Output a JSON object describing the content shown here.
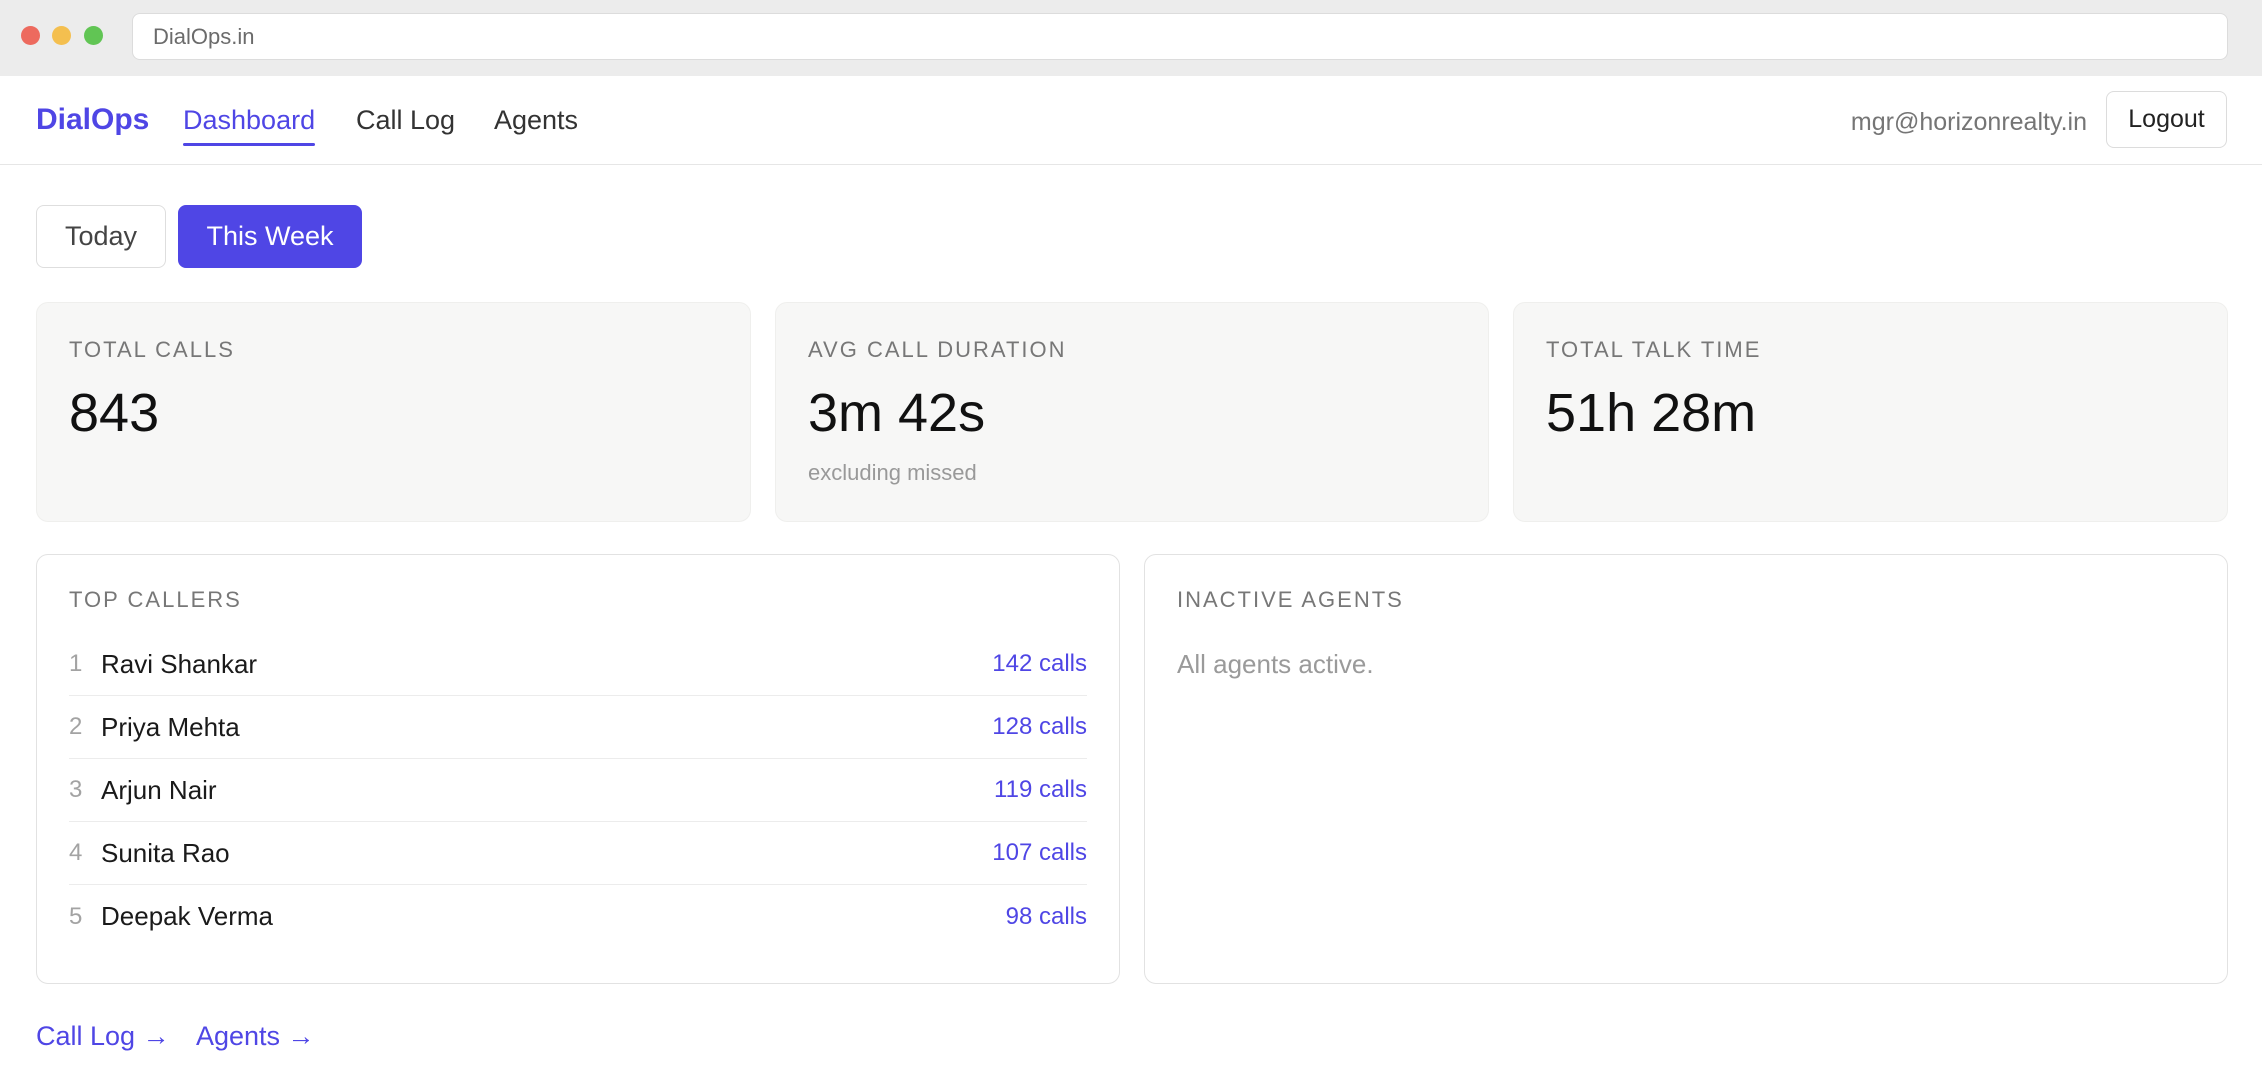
{
  "browser": {
    "url": "DialOps.in"
  },
  "header": {
    "brand": "DialOps",
    "nav": {
      "dashboard": "Dashboard",
      "call_log": "Call Log",
      "agents": "Agents"
    },
    "user_email": "mgr@horizonrealty.in",
    "logout": "Logout"
  },
  "range": {
    "today": "Today",
    "this_week": "This Week",
    "selected": "This Week"
  },
  "stats": {
    "total_calls": {
      "label": "TOTAL CALLS",
      "value": "843"
    },
    "avg_duration": {
      "label": "AVG CALL DURATION",
      "value": "3m 42s",
      "note": "excluding missed"
    },
    "talk_time": {
      "label": "TOTAL TALK TIME",
      "value": "51h 28m"
    }
  },
  "top_callers": {
    "title": "TOP CALLERS",
    "rows": [
      {
        "rank": "1",
        "name": "Ravi Shankar",
        "calls": "142 calls"
      },
      {
        "rank": "2",
        "name": "Priya Mehta",
        "calls": "128 calls"
      },
      {
        "rank": "3",
        "name": "Arjun Nair",
        "calls": "119 calls"
      },
      {
        "rank": "4",
        "name": "Sunita Rao",
        "calls": "107 calls"
      },
      {
        "rank": "5",
        "name": "Deepak Verma",
        "calls": "98 calls"
      }
    ]
  },
  "inactive_agents": {
    "title": "INACTIVE AGENTS",
    "empty": "All agents active."
  },
  "footer": {
    "call_log": "Call Log →",
    "agents": "Agents →"
  },
  "colors": {
    "accent": "#4f46e5",
    "card_bg": "#f7f7f6"
  }
}
